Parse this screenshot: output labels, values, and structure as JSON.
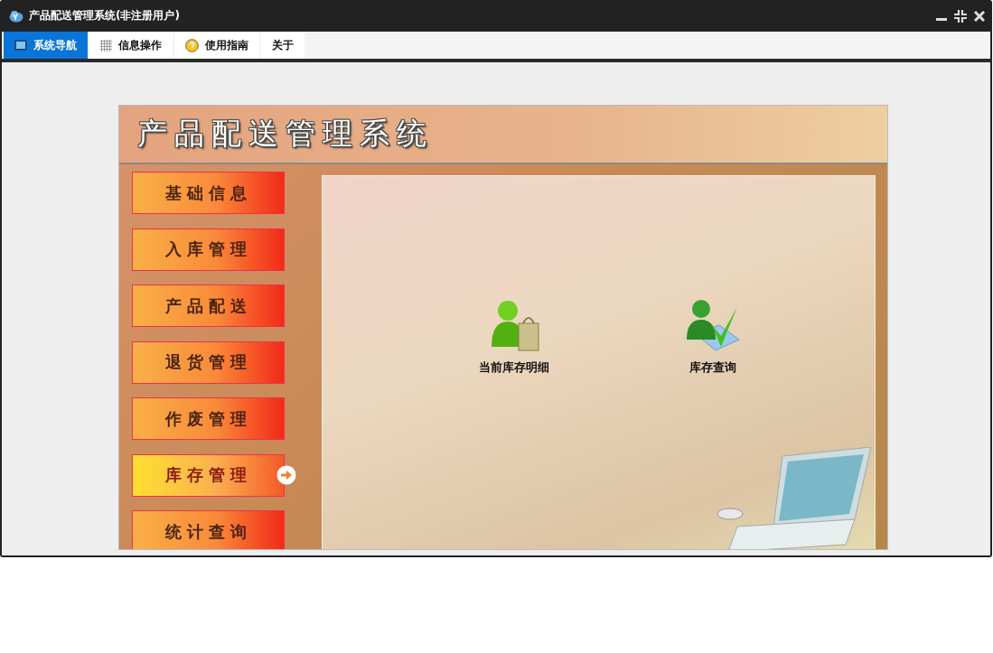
{
  "window": {
    "title": "产品配送管理系统(非注册用户)"
  },
  "tabs": [
    {
      "label": "系统导航",
      "selected": true,
      "kind": "monitor"
    },
    {
      "label": "信息操作",
      "selected": false,
      "kind": "grid"
    },
    {
      "label": "使用指南",
      "selected": false,
      "kind": "help"
    },
    {
      "label": "关于",
      "selected": false,
      "kind": "plain"
    }
  ],
  "app": {
    "title": "产品配送管理系统"
  },
  "nav": [
    {
      "label": "基础信息",
      "selected": false
    },
    {
      "label": "入库管理",
      "selected": false
    },
    {
      "label": "产品配送",
      "selected": false
    },
    {
      "label": "退货管理",
      "selected": false
    },
    {
      "label": "作废管理",
      "selected": false
    },
    {
      "label": "库存管理",
      "selected": true
    },
    {
      "label": "统计查询",
      "selected": false
    }
  ],
  "shortcuts": [
    {
      "label": "当前库存明细",
      "kind": "bag"
    },
    {
      "label": "库存查询",
      "kind": "check"
    }
  ]
}
